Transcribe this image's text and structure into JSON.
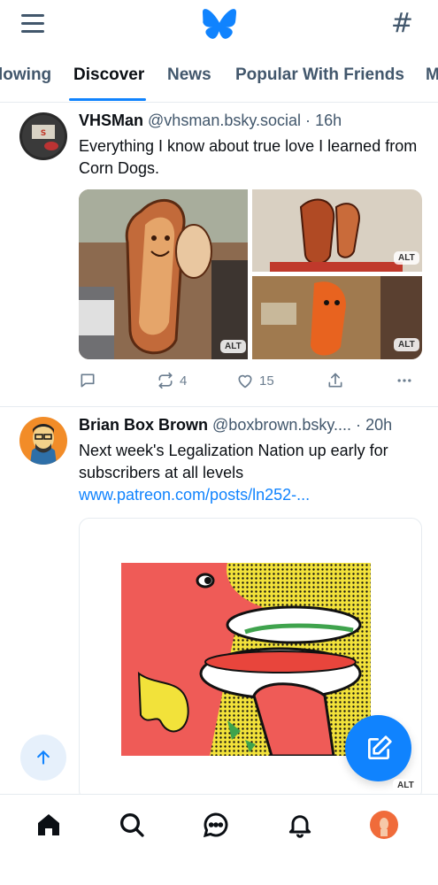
{
  "header": {
    "menu_icon": "hamburger-menu-icon",
    "logo_icon": "butterfly-icon",
    "feeds_icon": "hash-icon",
    "feeds_symbol": "#",
    "brand_color": "#1083fe"
  },
  "tabs": [
    {
      "label": "lowing",
      "active": false
    },
    {
      "label": "Discover",
      "active": true
    },
    {
      "label": "News",
      "active": false
    },
    {
      "label": "Popular With Friends",
      "active": false
    },
    {
      "label": "M",
      "active": false
    }
  ],
  "posts": [
    {
      "author": "VHSMan",
      "handle": "@vhsman.bsky.social",
      "separator": "·",
      "time": "16h",
      "text": "Everything I know about true love I learned from Corn Dogs.",
      "images_alt": [
        "ALT",
        "ALT",
        "ALT"
      ],
      "actions": {
        "reply_count": "",
        "repost_count": "4",
        "like_count": "15"
      }
    },
    {
      "author": "Brian Box Brown",
      "handle": "@boxbrown.bsky....",
      "separator": "·",
      "time": "20h",
      "text": "Next week's Legalization Nation up early for subscribers at all levels",
      "link": "www.patreon.com/posts/ln252-..."
    }
  ],
  "floating": {
    "scroll_top_icon": "arrow-up-icon",
    "compose_icon": "compose-icon",
    "alt_label": "ALT"
  },
  "bottom_nav": [
    {
      "name": "home-icon",
      "active": true
    },
    {
      "name": "search-icon",
      "active": false
    },
    {
      "name": "chat-icon",
      "active": false
    },
    {
      "name": "bell-icon",
      "active": false
    },
    {
      "name": "profile-avatar",
      "active": false
    }
  ]
}
